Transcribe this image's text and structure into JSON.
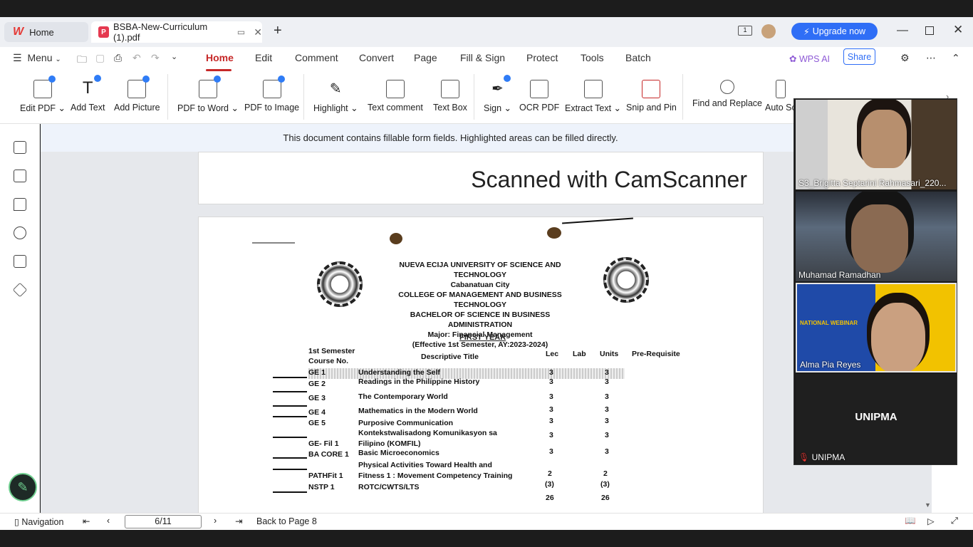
{
  "tabs": {
    "home_label": "Home",
    "doc_label": "BSBA-New-Curriculum (1).pdf"
  },
  "top_right": {
    "upgrade_label": "Upgrade now"
  },
  "menu": {
    "menu_label": "Menu",
    "items": [
      "Home",
      "Edit",
      "Comment",
      "Convert",
      "Page",
      "Fill & Sign",
      "Protect",
      "Tools",
      "Batch"
    ],
    "wps_ai": "WPS AI",
    "share": "Share"
  },
  "ribbon": {
    "buttons": [
      "Edit PDF",
      "Add Text",
      "Add Picture",
      "PDF to Word",
      "PDF to Image",
      "Highlight",
      "Text comment",
      "Text Box",
      "Sign",
      "OCR PDF",
      "Extract Text",
      "Snip and Pin",
      "Find and Replace",
      "Auto Sc"
    ]
  },
  "notice": "This document contains fillable form fields. Highlighted areas can be filled directly.",
  "page1": {
    "text": "Scanned with CamScanner"
  },
  "doc": {
    "header_lines": [
      "NUEVA ECIJA UNIVERSITY OF SCIENCE AND TECHNOLOGY",
      "Cabanatuan City",
      "COLLEGE OF MANAGEMENT AND BUSINESS TECHNOLOGY",
      "BACHELOR OF SCIENCE IN BUSINESS ADMINISTRATION",
      "Major: Financial Management",
      "(Effective 1st Semester, AY:2023-2024)"
    ],
    "year": "FIRST YEAR",
    "semester": "1st Semester",
    "col_course": "Course No.",
    "col_title": "Descriptive Title",
    "col_lec": "Lec",
    "col_lab": "Lab",
    "col_units": "Units",
    "col_prereq": "Pre-Requisite",
    "rows": [
      {
        "code": "GE 1",
        "title": "Understanding the Self",
        "lec": "3",
        "units": "3"
      },
      {
        "code": "GE 2",
        "title": "Readings in the Philippine History",
        "lec": "3",
        "units": "3"
      },
      {
        "code": "GE 3",
        "title": "The Contemporary World",
        "lec": "3",
        "units": "3"
      },
      {
        "code": "GE 4",
        "title": "Mathematics in the Modern World",
        "lec": "3",
        "units": "3"
      },
      {
        "code": "GE 5",
        "title": "Purposive Communication",
        "lec": "3",
        "units": "3"
      },
      {
        "code": "GE- Fil 1",
        "title": "Kontekstwalisadong Komunikasyon sa Filipino (KOMFIL)",
        "lec": "3",
        "units": "3"
      },
      {
        "code": "BA CORE 1",
        "title": "Basic Microeconomics",
        "lec": "3",
        "units": "3"
      },
      {
        "code": "PATHFit 1",
        "title": "Physical Activities Toward Health and Fitness 1 : Movement Competency Training",
        "lec": "2",
        "units": "2"
      },
      {
        "code": "NSTP 1",
        "title": "ROTC/CWTS/LTS",
        "lec": "(3)",
        "units": "(3)"
      }
    ],
    "total_lec": "26",
    "total_units": "26"
  },
  "video": {
    "p1": "S3_Brigitta Septarini Rahmasari_220...",
    "p2": "Muhamad Ramadhan",
    "p3": "Alma Pia Reyes",
    "p4_big": "UNIPMA",
    "p4": "UNIPMA",
    "webinar_text": "NATIONAL WEBINAR"
  },
  "status": {
    "navigation": "Navigation",
    "page": "6/11",
    "back": "Back to Page 8"
  }
}
